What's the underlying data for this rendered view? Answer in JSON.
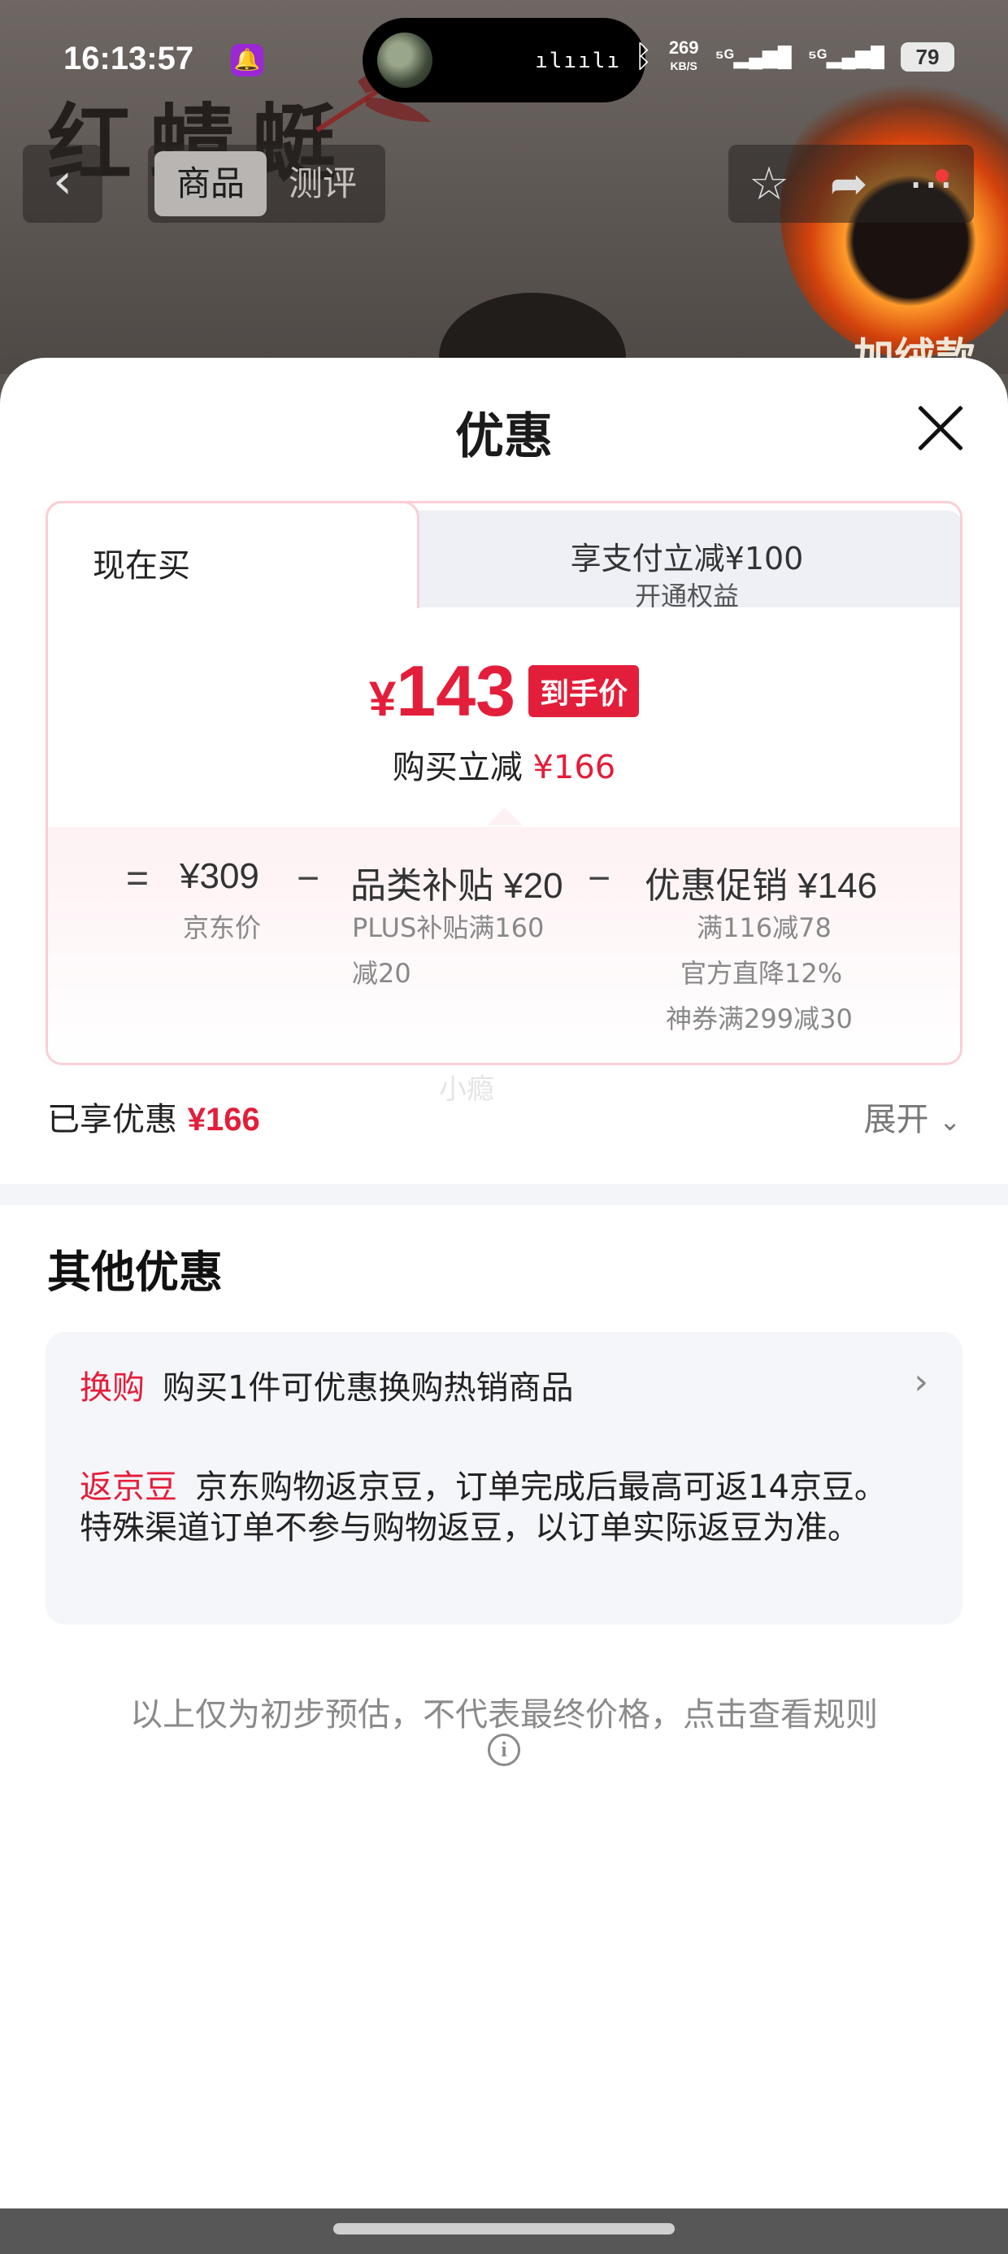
{
  "status_bar": {
    "time": "16:13:57",
    "net_speed": "269",
    "net_unit": "KB/S",
    "sig1": "⁵ᴳ",
    "sig2": "⁵ᴳ",
    "battery": "79"
  },
  "background": {
    "brand": "红蜻蜓",
    "fire_text": "加绒款"
  },
  "nav": {
    "tab_product": "商品",
    "tab_review": "测评"
  },
  "sheet": {
    "title": "优惠",
    "tab_now": "现在买",
    "tab_pay_main": "享支付立减¥100",
    "tab_pay_sub": "开通权益",
    "price_currency": "¥",
    "price_value": "143",
    "price_badge": "到手价",
    "reduce_label": "购买立减",
    "reduce_amount": "¥166",
    "breakdown": {
      "equals": "=",
      "jd_price": "¥309",
      "jd_price_label": "京东价",
      "minus1": "−",
      "category_subsidy": "品类补贴 ¥20",
      "category_sub_1": "PLUS补贴满160",
      "category_sub_2": "减20",
      "minus2": "−",
      "promo": "优惠促销 ¥146",
      "promo_sub_1": "满116减78",
      "promo_sub_2": "官方直降12%",
      "promo_sub_3": "神券满299减30"
    },
    "faint_text": "小瘾",
    "enjoyed_label": "已享优惠",
    "enjoyed_amount": "¥166",
    "expand_label": "展开",
    "other_title": "其他优惠",
    "exchange_tag": "换购",
    "exchange_text": "购买1件可优惠换购热销商品",
    "bean_tag": "返京豆",
    "bean_text": "京东购物返京豆，订单完成后最高可返14京豆。特殊渠道订单不参与购物返豆，以订单实际返豆为准。",
    "disclaimer": "以上仅为初步预估，不代表最终价格，点击查看规则"
  }
}
